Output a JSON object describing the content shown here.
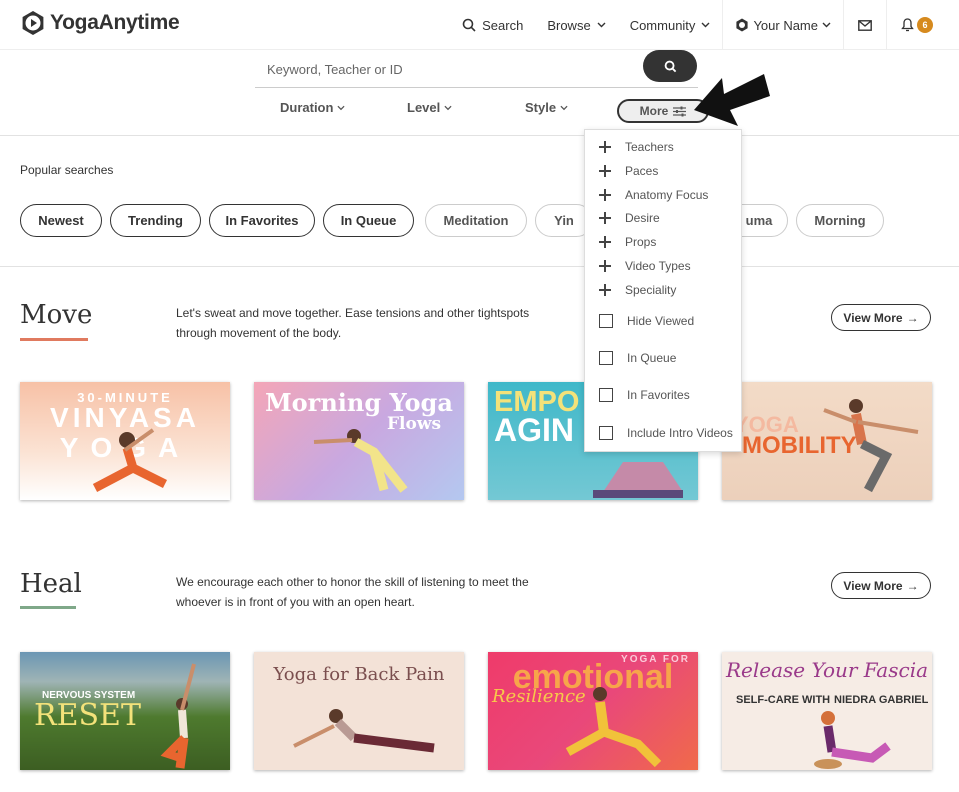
{
  "header": {
    "logo_text": "YogaAnytime",
    "search_label": "Search",
    "browse_label": "Browse",
    "community_label": "Community",
    "user_label": "Your Name",
    "notification_count": "6"
  },
  "search": {
    "placeholder": "Keyword, Teacher or ID"
  },
  "filters": {
    "duration": "Duration",
    "level": "Level",
    "style": "Style",
    "more": "More"
  },
  "popular": {
    "label": "Popular searches",
    "pills": [
      "Newest",
      "Trending",
      "In Favorites",
      "In Queue",
      "Meditation",
      "Yin",
      "uma",
      "Morning"
    ]
  },
  "dropdown": {
    "expandables": [
      "Teachers",
      "Paces",
      "Anatomy Focus",
      "Desire",
      "Props",
      "Video Types",
      "Speciality"
    ],
    "checkboxes": [
      "Hide Viewed",
      "In Queue",
      "In Favorites",
      "Include Intro Videos"
    ]
  },
  "sections": {
    "move": {
      "title": "Move",
      "desc_line1": "Let's sweat and move together. Ease tensions and other tightspots",
      "desc_line2": "through movement of the body.",
      "view_more": "View More",
      "accent": "#e07a5f",
      "cards": [
        {
          "line1": "30-MINUTE",
          "line2": "VINYASA",
          "line3": "YOGA"
        },
        {
          "line1": "Morning Yoga",
          "line2": "Flows"
        },
        {
          "line1": "EMPO",
          "line2": "AGIN"
        },
        {
          "line1": "YOGA",
          "line2": "MOBILITY"
        }
      ]
    },
    "heal": {
      "title": "Heal",
      "desc_line1": "We encourage each other to honor the skill of listening to meet the",
      "desc_line2": "whoever is in front of you with an open heart.",
      "view_more": "View More",
      "accent": "#7fa889",
      "cards": [
        {
          "line1": "NERVOUS SYSTEM",
          "line2": "RESET"
        },
        {
          "line1": "Yoga for Back Pain"
        },
        {
          "line1": "YOGA FOR",
          "line2": "emotional",
          "line3": "Resilience"
        },
        {
          "line1": "Release Your Fascia",
          "line2": "SELF-CARE WITH",
          "line3": "NIEDRA GABRIEL"
        }
      ]
    }
  }
}
